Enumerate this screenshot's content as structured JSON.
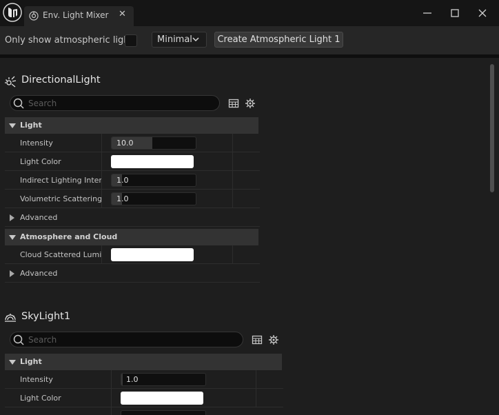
{
  "tab": {
    "title": "Env. Light Mixer",
    "close_glyph": "✕"
  },
  "toolbar": {
    "atmospheric_only_label": "Only show atmospheric lights",
    "atmospheric_only_checked": false,
    "mode_select": "Minimal",
    "create_button": "Create Atmospheric Light 1"
  },
  "panels": [
    {
      "title": "DirectionalLight",
      "icon": "directional-light-icon",
      "search_placeholder": "Search",
      "categories": [
        {
          "label": "Light",
          "properties": [
            {
              "label": "Intensity",
              "type": "number",
              "value": "10.0",
              "fill": 0.48
            },
            {
              "label": "Light Color",
              "type": "color",
              "color": "#ffffff"
            },
            {
              "label": "Indirect Lighting Inten...",
              "type": "number",
              "value": "1.0",
              "fill": 0.12
            },
            {
              "label": "Volumetric Scattering...",
              "type": "number",
              "value": "1.0",
              "fill": 0.12
            }
          ],
          "advanced_label": "Advanced"
        },
        {
          "label": "Atmosphere and Cloud",
          "properties": [
            {
              "label": "Cloud Scattered Lumi...",
              "type": "color",
              "color": "#ffffff"
            }
          ],
          "advanced_label": "Advanced"
        }
      ]
    },
    {
      "title": "SkyLight1",
      "icon": "sky-light-icon",
      "search_placeholder": "Search",
      "categories": [
        {
          "label": "Light",
          "properties": [
            {
              "label": "Intensity",
              "type": "number",
              "value": "1.0",
              "fill": 0.02
            },
            {
              "label": "Light Color",
              "type": "color",
              "color": "#ffffff"
            }
          ]
        }
      ]
    }
  ],
  "colors": {
    "background": "#1e1e1e",
    "titlebar": "#151515",
    "toolbar": "#262626",
    "category_header": "#333333",
    "color_swatch": "#ffffff"
  }
}
